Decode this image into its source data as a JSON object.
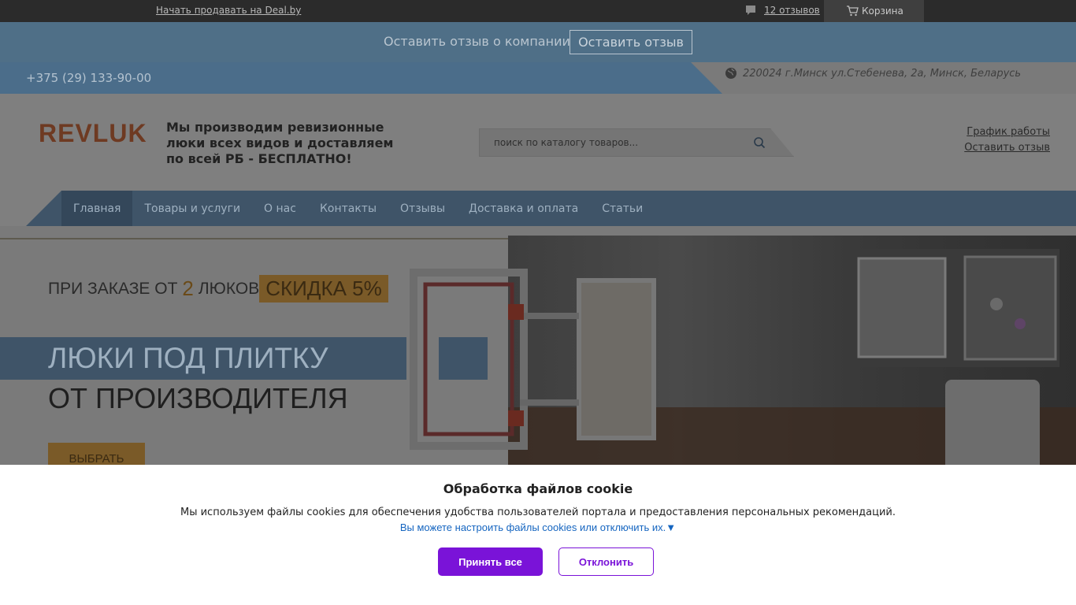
{
  "topbar": {
    "sell_link": "Начать продавать на Deal.by",
    "reviews_link": "12 отзывов",
    "cart_label": "Корзина"
  },
  "review_strip": {
    "label": "Оставить отзыв о компании",
    "button": "Оставить отзыв"
  },
  "contact": {
    "phone": "+375 (29) 133-90-00",
    "address": "220024 г.Минск ул.Стебенева, 2а, Минск, Беларусь"
  },
  "header": {
    "logo": "REVLUK",
    "slogan": "Мы производим ревизионные люки всех видов и доставляем по всей РБ - БЕСПЛАТНО!",
    "search_placeholder": "поиск по каталогу товаров...",
    "schedule_link": "График работы",
    "review_link": "Оставить отзыв"
  },
  "nav": {
    "items": [
      {
        "label": "Главная"
      },
      {
        "label": "Товары и услуги"
      },
      {
        "label": "О нас"
      },
      {
        "label": "Контакты"
      },
      {
        "label": "Отзывы"
      },
      {
        "label": "Доставка и оплата"
      },
      {
        "label": "Статьи"
      }
    ]
  },
  "banner": {
    "promo_prefix": "ПРИ ЗАКАЗЕ ОТ",
    "promo_count": "2",
    "promo_suffix": "ЛЮКОВ",
    "promo_discount": "СКИДКА 5%",
    "headline_1": "ЛЮКИ ПОД ПЛИТКУ",
    "headline_2": "ОТ ПРОИЗВОДИТЕЛЯ",
    "choose_button": "ВЫБРАТЬ"
  },
  "cookie": {
    "title": "Обработка файлов cookie",
    "text": "Мы используем файлы cookies для обеспечения удобства пользователей портала и предоставления персональных рекомендаций.",
    "settings_link": "Вы можете настроить файлы cookies или отключить их.▼",
    "accept": "Принять все",
    "decline": "Отклонить"
  },
  "colors": {
    "accent_purple": "#7a13d8",
    "link_blue": "#1565c0",
    "nav_blue": "#3f5468",
    "brand_orange": "#e8702a"
  },
  "icons": [
    "comment-icon",
    "cart-icon",
    "globe-icon",
    "search-icon"
  ]
}
